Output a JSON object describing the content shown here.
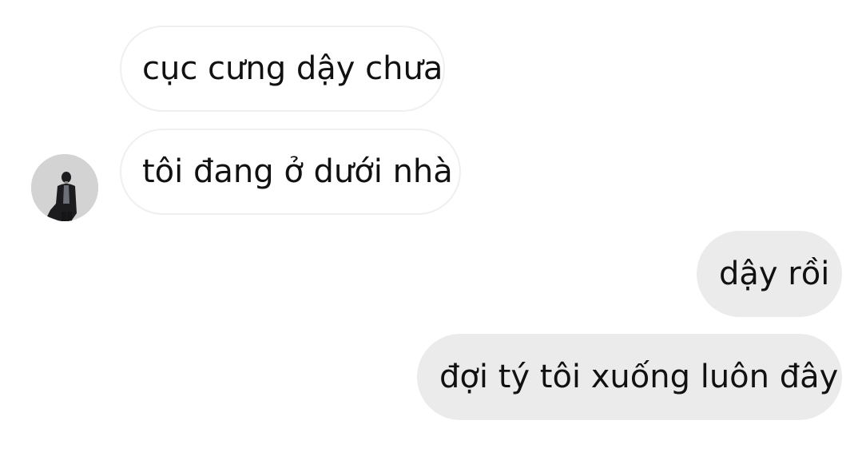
{
  "conversation": {
    "messages": [
      {
        "direction": "incoming",
        "text": "cục cưng dậy chưa"
      },
      {
        "direction": "incoming",
        "text": "tôi đang ở dưới nhà"
      },
      {
        "direction": "outgoing",
        "text": "dậy rồi"
      },
      {
        "direction": "outgoing",
        "text": "đợi tý tôi xuống luôn đây"
      }
    ],
    "contact_avatar": "person-photo-avatar"
  },
  "colors": {
    "incoming_bubble": "#ffffff",
    "incoming_border": "#efefef",
    "outgoing_bubble": "#ebebeb",
    "text": "#111111"
  }
}
